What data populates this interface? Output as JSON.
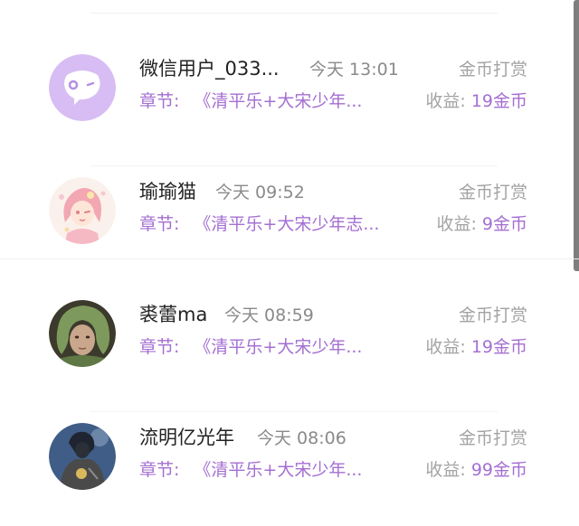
{
  "items": [
    {
      "name": "微信用户_033...",
      "time": "今天 13:01",
      "type_label": "金币打赏",
      "chapter_label": "章节:",
      "chapter_title": "《清平乐+大宋少年...",
      "income_label": "收益:",
      "income_value": "19金币",
      "avatar_icon": "chat-bubble-icon"
    },
    {
      "name": "瑜瑜猫",
      "time": "今天 09:52",
      "type_label": "金币打赏",
      "chapter_label": "章节:",
      "chapter_title": "《清平乐+大宋少年志...",
      "income_label": "收益:",
      "income_value": "9金币",
      "avatar_icon": "anime-girl-avatar"
    },
    {
      "name": "裘蕾ma",
      "time": "今天 08:59",
      "type_label": "金币打赏",
      "chapter_label": "章节:",
      "chapter_title": "《清平乐+大宋少年...",
      "income_label": "收益:",
      "income_value": "19金币",
      "avatar_icon": "photo-avatar"
    },
    {
      "name": "流明亿光年",
      "time": "今天 08:06",
      "type_label": "金币打赏",
      "chapter_label": "章节:",
      "chapter_title": "《清平乐+大宋少年...",
      "income_label": "收益:",
      "income_value": "99金币",
      "avatar_icon": "photo-avatar"
    }
  ],
  "colors": {
    "accent": "#a46fd2",
    "avatar_default_bg": "#d7bdf3",
    "muted_text": "#a3a3a3"
  }
}
